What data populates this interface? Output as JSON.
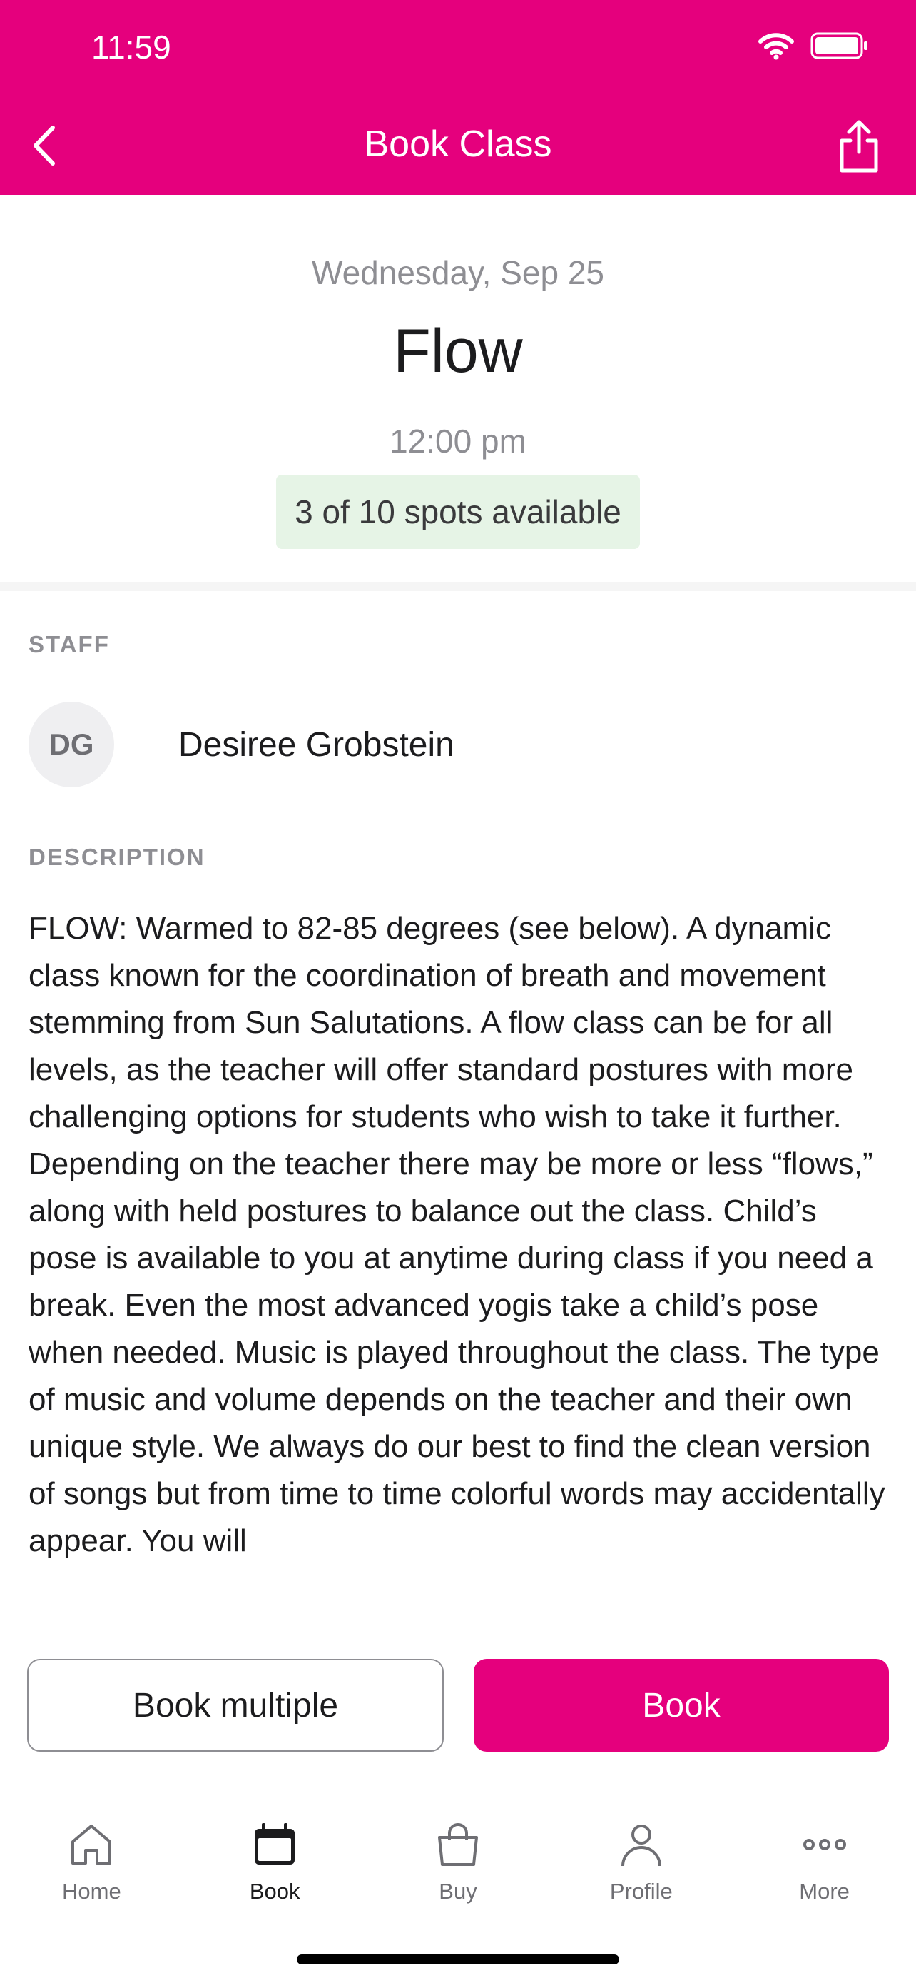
{
  "status_bar": {
    "time": "11:59"
  },
  "nav": {
    "title": "Book Class"
  },
  "class": {
    "date": "Wednesday, Sep 25",
    "name": "Flow",
    "time": "12:00 pm",
    "spots": "3 of 10 spots available"
  },
  "staff": {
    "section_label": "STAFF",
    "initials": "DG",
    "name": "Desiree Grobstein"
  },
  "description": {
    "section_label": "DESCRIPTION",
    "text": "FLOW: Warmed to 82-85 degrees (see below). A dynamic class known for the coordination of breath and movement stemming from Sun Salutations. A flow class can be for all levels, as the teacher will offer standard postures with more challenging options for students who wish to take it further. Depending on the teacher there may be more or less “flows,” along with held postures to balance out the class. Child’s pose is available to you at anytime during class if you need a break. Even the most advanced yogis take a child’s pose when needed. Music is played throughout the class. The type of music and volume depends on the teacher and their own unique style. We always do our best to find the clean version of songs but from time to time colorful words may accidentally appear.  You will"
  },
  "actions": {
    "book_multiple": "Book multiple",
    "book": "Book"
  },
  "tabbar": {
    "items": [
      {
        "label": "Home",
        "icon": "home-icon",
        "active": false
      },
      {
        "label": "Book",
        "icon": "calendar-icon",
        "active": true
      },
      {
        "label": "Buy",
        "icon": "bag-icon",
        "active": false
      },
      {
        "label": "Profile",
        "icon": "person-icon",
        "active": false
      },
      {
        "label": "More",
        "icon": "more-icon",
        "active": false
      }
    ]
  },
  "colors": {
    "brand": "#e5007d",
    "spots_badge_bg": "#e6f4e6"
  }
}
